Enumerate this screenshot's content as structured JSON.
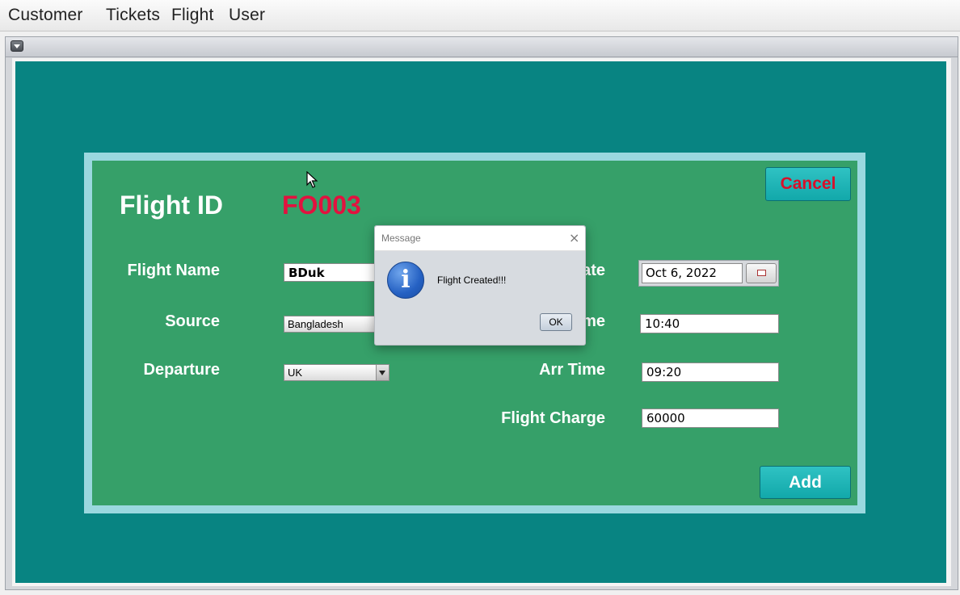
{
  "menubar": {
    "items": [
      "Customer",
      "Tickets",
      "Flight",
      "User"
    ]
  },
  "form": {
    "flight_id_label": "Flight ID",
    "flight_id_value": "FO003",
    "flight_name_label": "Flight Name",
    "flight_name_value": "BDuk",
    "source_label": "Source",
    "source_value": "Bangladesh",
    "departure_label": "Departure",
    "departure_value": "UK",
    "date_label": "ate",
    "date_value": "Oct 6, 2022",
    "dep_time_label": "me",
    "dep_time_value": "10:40",
    "arr_time_label": "Arr Time",
    "arr_time_value": "09:20",
    "flight_charge_label": "Flight Charge",
    "flight_charge_value": "60000",
    "cancel_label": "Cancel",
    "add_label": "Add"
  },
  "dialog": {
    "title": "Message",
    "close": "×",
    "message": "Flight Created!!!",
    "ok_label": "OK",
    "icon": "info-icon"
  },
  "colors": {
    "teal_bg": "#088482",
    "panel_green": "#36a069",
    "panel_border": "#9ad8df",
    "flight_id_red": "#e2123f",
    "cancel_red": "#d8102a",
    "button_teal": "#1fb5b6"
  }
}
